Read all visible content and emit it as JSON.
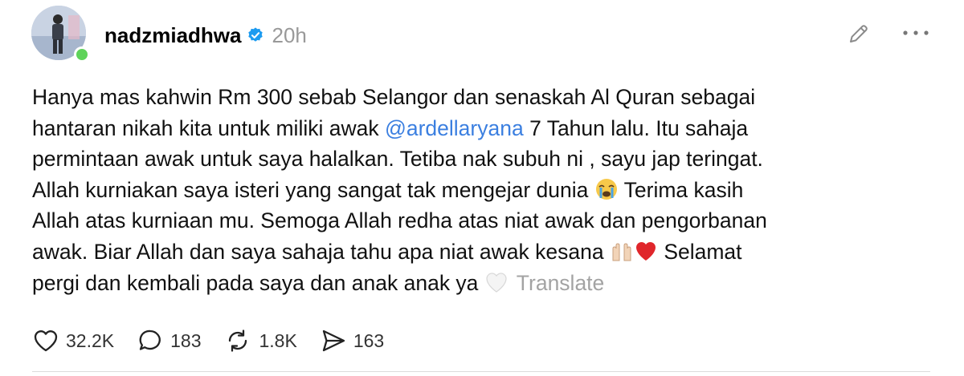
{
  "post": {
    "username": "nadzmiadhwa",
    "time": "20h",
    "lines": [
      {
        "text": "Hanya mas kahwin Rm 300 sebab Selangor dan senaskah Al Quran sebagai"
      },
      {
        "pre": "hantaran nikah kita untuk miliki awak ",
        "mention": "@ardellaryana",
        "post": " 7 Tahun lalu. Itu sahaja"
      },
      {
        "text": "permintaan awak untuk saya halalkan. Tetiba nak subuh ni , sayu jap teringat."
      },
      {
        "text": "Allah kurniakan saya isteri yang sangat tak mengejar dunia",
        "emoji": "loudly-crying-face",
        "post": "Terima kasih"
      },
      {
        "text": "Allah atas kurniaan mu. Semoga Allah redha atas niat awak dan pengorbanan"
      },
      {
        "text": "awak. Biar Allah dan saya sahaja tahu apa niat awak kesana",
        "emoji1": "palms-up-together",
        "emoji2": "red-heart",
        "post": "Selamat"
      },
      {
        "text": "pergi dan kembali pada saya dan anak anak ya",
        "emoji": "white-heart"
      }
    ],
    "translate_label": "Translate"
  },
  "actions": {
    "likes": "32.2K",
    "replies": "183",
    "reposts": "1.8K",
    "shares": "163"
  },
  "colors": {
    "mention": "#3b7fe0",
    "verified": "#1d9bf0",
    "online": "#5fd35a",
    "muted": "#999999"
  }
}
